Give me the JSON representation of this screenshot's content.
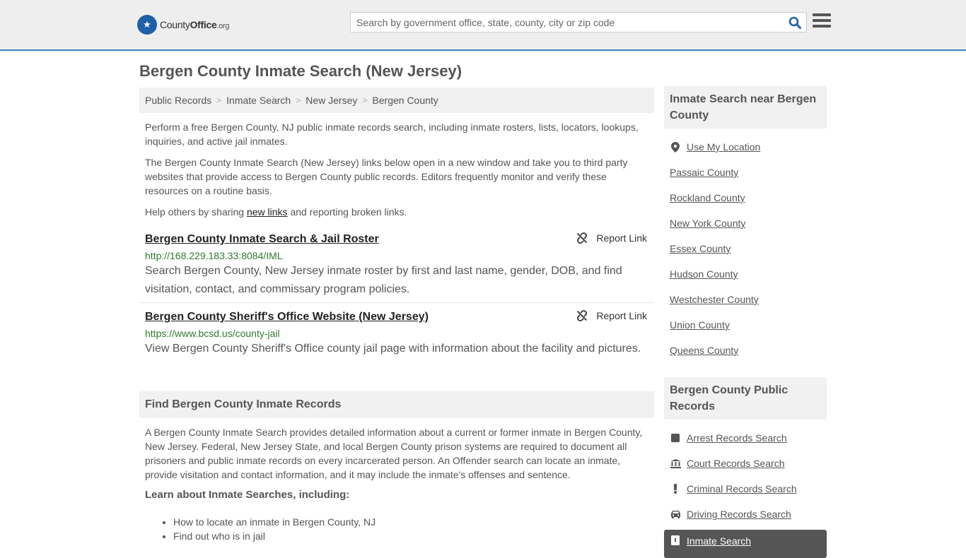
{
  "header": {
    "logo_prefix": "County",
    "logo_bold": "Office",
    "logo_suffix": ".org",
    "search_placeholder": "Search by government office, state, county, city or zip code",
    "accent_color": "#3d7ec0"
  },
  "page_title": "Bergen County Inmate Search (New Jersey)",
  "breadcrumb": [
    "Public Records",
    "Inmate Search",
    "New Jersey",
    "Bergen County"
  ],
  "intro": {
    "p1": "Perform a free Bergen County, NJ public inmate records search, including inmate rosters, lists, locators, lookups, inquiries, and active jail inmates.",
    "p2": "The Bergen County Inmate Search (New Jersey) links below open in a new window and take you to third party websites that provide access to Bergen County public records. Editors frequently monitor and verify these resources on a routine basis.",
    "p3_before": "Help others by sharing ",
    "p3_link": "new links",
    "p3_after": " and reporting broken links."
  },
  "results": [
    {
      "title": "Bergen County Inmate Search & Jail Roster",
      "url": "http://168.229.183.33:8084/IML",
      "desc": "Search Bergen County, New Jersey inmate roster by first and last name, gender, DOB, and find visitation, contact, and commissary program policies.",
      "report_label": "Report Link"
    },
    {
      "title": "Bergen County Sheriff's Office Website (New Jersey)",
      "url": "https://www.bcsd.us/county-jail",
      "desc": "View Bergen County Sheriff's Office county jail page with information about the facility and pictures.",
      "report_label": "Report Link"
    }
  ],
  "find_section": {
    "heading": "Find Bergen County Inmate Records",
    "body": "A Bergen County Inmate Search provides detailed information about a current or former inmate in Bergen County, New Jersey. Federal, New Jersey State, and local Bergen County prison systems are required to document all prisoners and public inmate records on every incarcerated person. An Offender search can locate an inmate, provide visitation and contact information, and it may include the inmate's offenses and sentence.",
    "learn_heading": "Learn about Inmate Searches, including:",
    "learn_items": [
      "How to locate an inmate in Bergen County, NJ",
      "Find out who is in jail"
    ]
  },
  "sidebar": {
    "nearby_heading": "Inmate Search near Bergen County",
    "use_location": "Use My Location",
    "nearby": [
      "Passaic County",
      "Rockland County",
      "New York County",
      "Essex County",
      "Hudson County",
      "Westchester County",
      "Union County",
      "Queens County"
    ],
    "records_heading": "Bergen County Public Records",
    "records": [
      {
        "label": "Arrest Records Search",
        "icon": "square-icon"
      },
      {
        "label": "Court Records Search",
        "icon": "courthouse-icon"
      },
      {
        "label": "Criminal Records Search",
        "icon": "exclamation-icon"
      },
      {
        "label": "Driving Records Search",
        "icon": "car-icon"
      }
    ],
    "active_record": "Inmate Search"
  }
}
